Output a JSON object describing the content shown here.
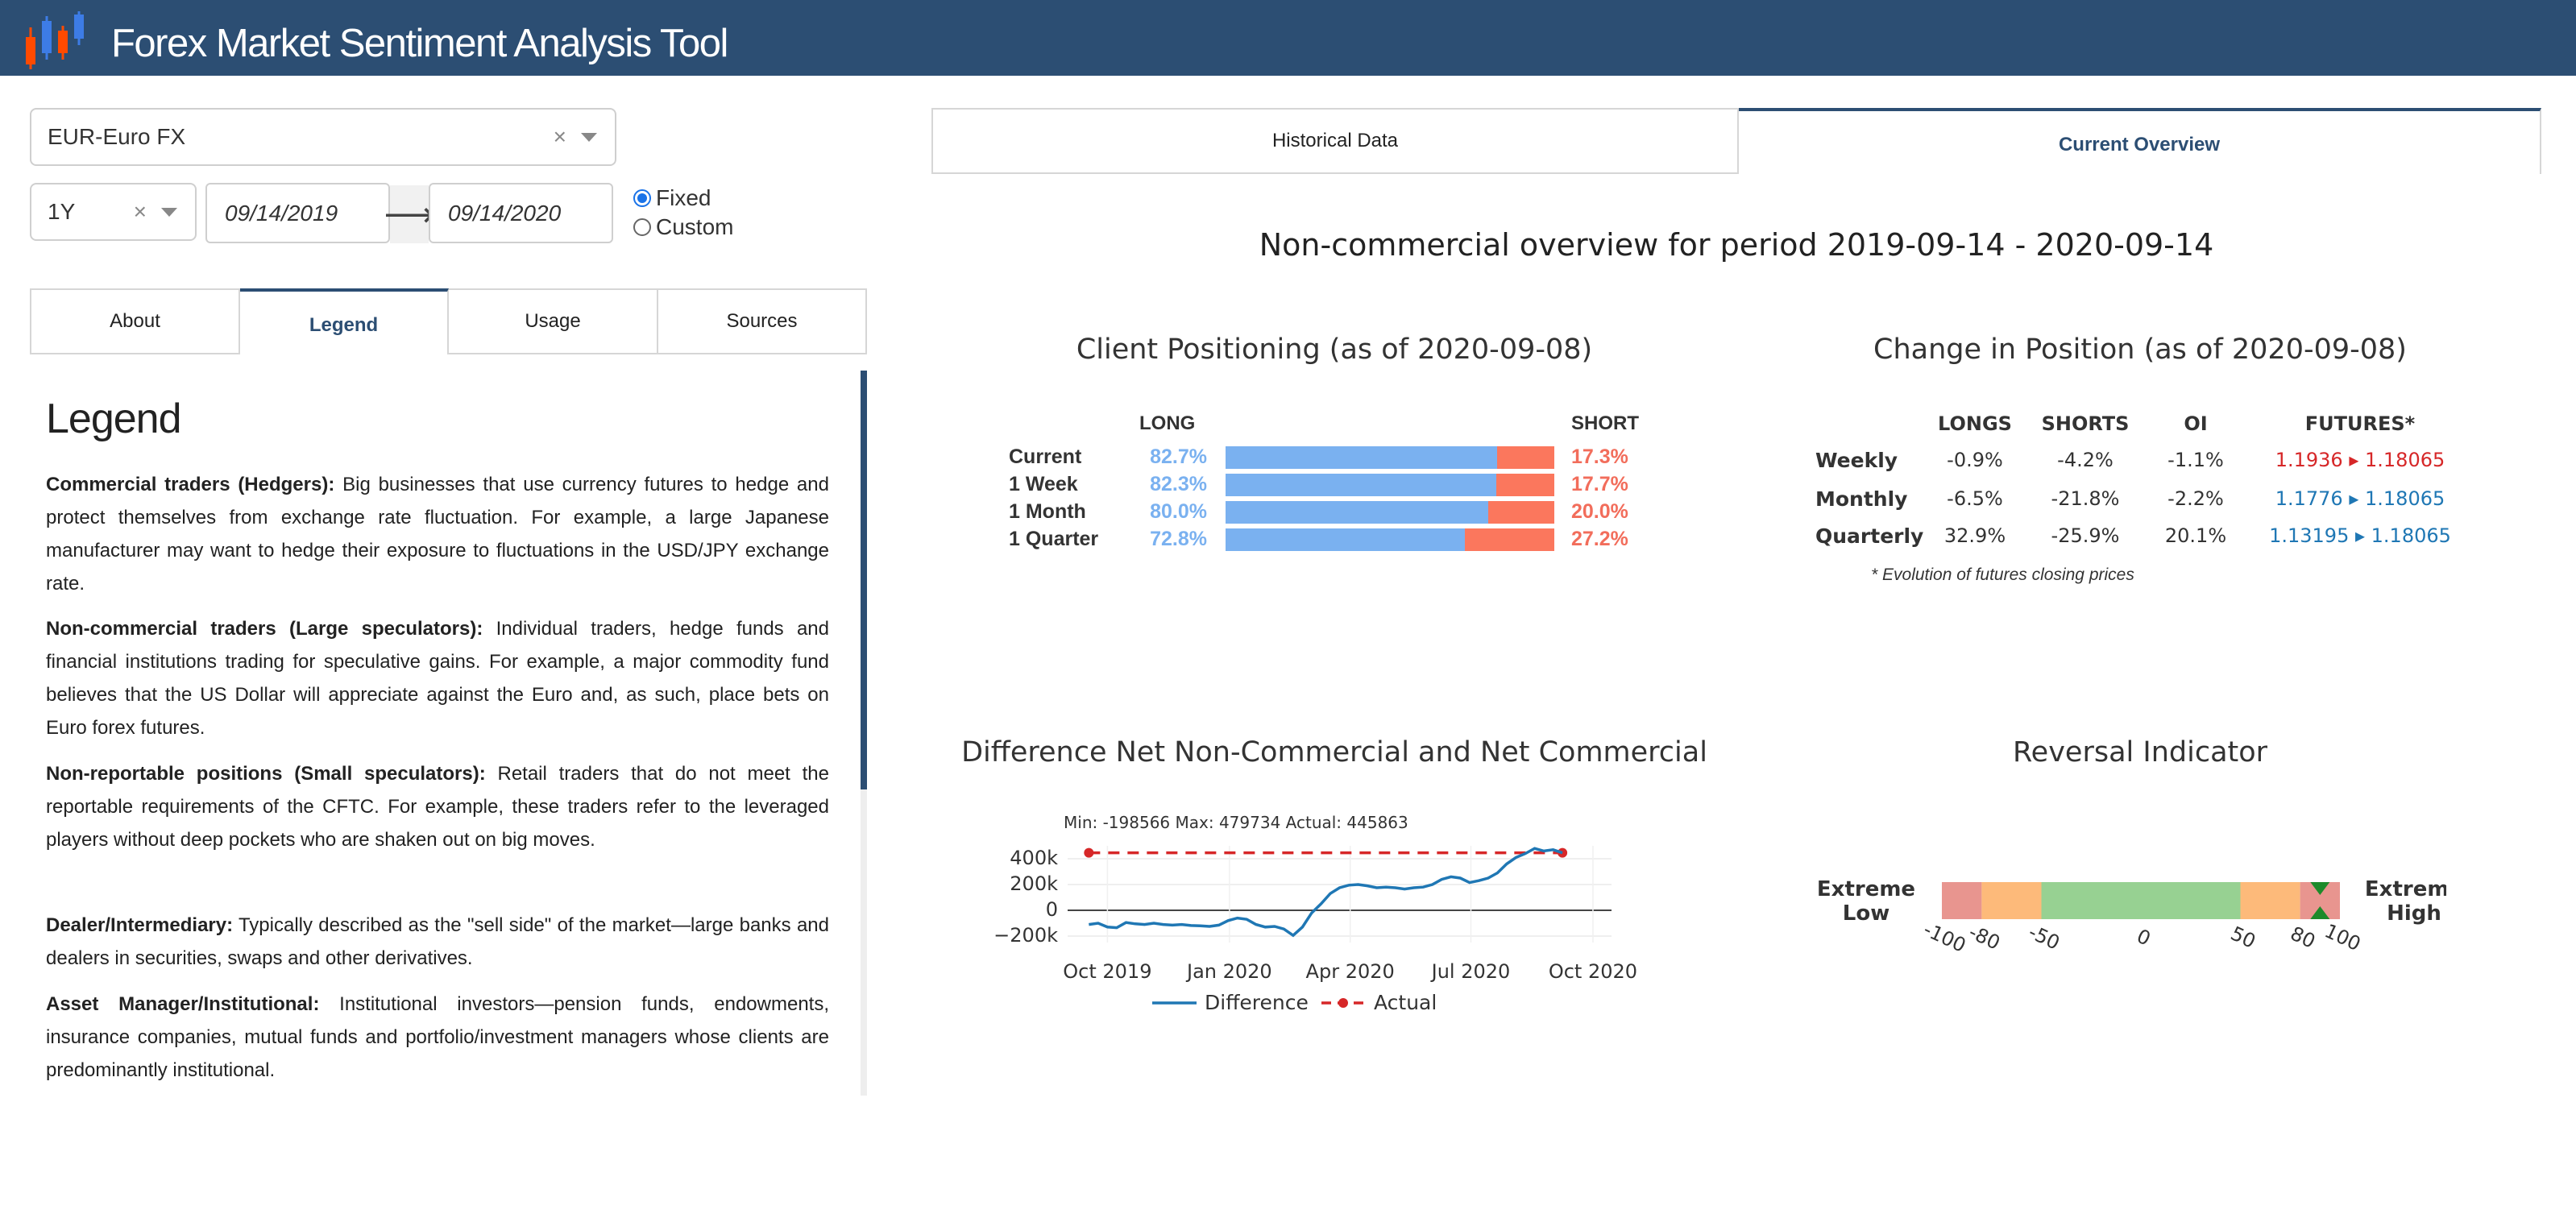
{
  "app": {
    "title": "Forex Market Sentiment Analysis Tool"
  },
  "colors": {
    "header_bg": "#2c4e73",
    "long": "#7ab1f0",
    "short": "#fb775d",
    "up": "#1f77b4",
    "down": "#d62728"
  },
  "controls": {
    "currency": {
      "value": "EUR-Euro FX",
      "clear": "×"
    },
    "period": {
      "value": "1Y",
      "clear": "×"
    },
    "start_date": "09/14/2019",
    "end_date": "09/14/2020",
    "arrow": "⟶",
    "radio_fixed": "Fixed",
    "radio_custom": "Custom",
    "selected_radio": "Fixed"
  },
  "left_tabs": [
    "About",
    "Legend",
    "Usage",
    "Sources"
  ],
  "left_active_tab": "Legend",
  "right_tabs": [
    "Historical Data",
    "Current Overview"
  ],
  "right_active_tab": "Current Overview",
  "legend": {
    "heading": "Legend",
    "items": [
      {
        "term": "Commercial traders (Hedgers):",
        "text": " Big businesses that use currency futures to hedge and protect themselves from exchange rate fluctuation. For example, a large Japanese manufacturer may want to hedge their exposure to fluctuations in the USD/JPY exchange rate."
      },
      {
        "term": "Non-commercial traders (Large speculators):",
        "text": " Individual traders, hedge funds and financial institutions trading for speculative gains. For example, a major commodity fund believes that the US Dollar will appreciate against the Euro and, as such, place bets on Euro forex futures."
      },
      {
        "term": "Non-reportable positions (Small speculators):",
        "text": " Retail traders that do not meet the reportable requirements of the CFTC. For example, these traders refer to the leveraged players without deep pockets who are shaken out on big moves."
      },
      {
        "term": "Dealer/Intermediary:",
        "text": " Typically described as the \"sell side\" of the market—large banks and dealers in securities, swaps and other derivatives."
      },
      {
        "term": "Asset Manager/Institutional:",
        "text": " Institutional investors—pension funds, endowments, insurance companies, mutual funds and portfolio/investment managers whose clients are predominantly institutional."
      }
    ]
  },
  "overview": {
    "title": "Non-commercial overview for period 2019-09-14 - 2020-09-14",
    "positioning": {
      "title": "Client Positioning (as of 2020-09-08)",
      "long_header": "LONG",
      "short_header": "SHORT",
      "rows": [
        {
          "label": "Current",
          "long": "82.7%",
          "short": "17.3%",
          "long_frac": 0.827
        },
        {
          "label": "1 Week",
          "long": "82.3%",
          "short": "17.7%",
          "long_frac": 0.823
        },
        {
          "label": "1 Month",
          "long": "80.0%",
          "short": "20.0%",
          "long_frac": 0.8
        },
        {
          "label": "1 Quarter",
          "long": "72.8%",
          "short": "27.2%",
          "long_frac": 0.728
        }
      ]
    },
    "change": {
      "title": "Change in Position (as of 2020-09-08)",
      "headers": [
        "LONGS",
        "SHORTS",
        "OI",
        "FUTURES*"
      ],
      "rows": [
        {
          "label": "Weekly",
          "longs": "-0.9%",
          "shorts": "-4.2%",
          "oi": "-1.1%",
          "from": "1.1936",
          "to": "1.18065",
          "direction": "down"
        },
        {
          "label": "Monthly",
          "longs": "-6.5%",
          "shorts": "-21.8%",
          "oi": "-2.2%",
          "from": "1.1776",
          "to": "1.18065",
          "direction": "up"
        },
        {
          "label": "Quarterly",
          "longs": "32.9%",
          "shorts": "-25.9%",
          "oi": "20.1%",
          "from": "1.13195",
          "to": "1.18065",
          "direction": "up"
        }
      ],
      "footnote": "* Evolution of futures closing prices"
    },
    "reversal": {
      "title": "Reversal Indicator",
      "low_label_1": "Extreme",
      "low_label_2": "Low",
      "high_label_1": "Extreme",
      "high_label_2": "High",
      "ticks": [
        "-100",
        "-80",
        "-50",
        "0",
        "50",
        "80",
        "100"
      ],
      "value": 90
    }
  },
  "chart_data": {
    "type": "line",
    "title": "Difference Net Non-Commercial and Net Commercial",
    "annotation": "Min: -198566   Max: 479734   Actual: 445863",
    "x_ticks": [
      "Oct 2019",
      "Jan 2020",
      "Apr 2020",
      "Jul 2020",
      "Oct 2020"
    ],
    "y_ticks": [
      "400k",
      "200k",
      "0",
      "−200k"
    ],
    "ylim": [
      -250000,
      500000
    ],
    "x": [
      "2019-09-17",
      "2019-09-24",
      "2019-10-01",
      "2019-10-08",
      "2019-10-15",
      "2019-10-22",
      "2019-10-29",
      "2019-11-05",
      "2019-11-12",
      "2019-11-19",
      "2019-11-26",
      "2019-12-03",
      "2019-12-10",
      "2019-12-17",
      "2019-12-24",
      "2019-12-31",
      "2020-01-07",
      "2020-01-14",
      "2020-01-21",
      "2020-01-28",
      "2020-02-04",
      "2020-02-11",
      "2020-02-18",
      "2020-02-25",
      "2020-03-03",
      "2020-03-10",
      "2020-03-17",
      "2020-03-24",
      "2020-03-31",
      "2020-04-07",
      "2020-04-14",
      "2020-04-21",
      "2020-04-28",
      "2020-05-05",
      "2020-05-12",
      "2020-05-19",
      "2020-05-26",
      "2020-06-02",
      "2020-06-09",
      "2020-06-16",
      "2020-06-23",
      "2020-06-30",
      "2020-07-07",
      "2020-07-14",
      "2020-07-21",
      "2020-07-28",
      "2020-08-04",
      "2020-08-11",
      "2020-08-18",
      "2020-08-25",
      "2020-09-01",
      "2020-09-08"
    ],
    "series": [
      {
        "name": "Difference",
        "color": "#1f77b4",
        "values": [
          -110000,
          -100000,
          -130000,
          -135000,
          -95000,
          -105000,
          -110000,
          -100000,
          -110000,
          -115000,
          -110000,
          -118000,
          -120000,
          -125000,
          -115000,
          -80000,
          -60000,
          -70000,
          -110000,
          -130000,
          -125000,
          -145000,
          -195000,
          -130000,
          -20000,
          50000,
          130000,
          175000,
          195000,
          200000,
          190000,
          175000,
          180000,
          175000,
          165000,
          175000,
          180000,
          200000,
          240000,
          260000,
          250000,
          215000,
          230000,
          250000,
          290000,
          360000,
          410000,
          440000,
          480000,
          460000,
          470000,
          445863
        ]
      },
      {
        "name": "Actual",
        "color": "#d62728",
        "dashed": true,
        "values": [
          445863,
          445863
        ]
      }
    ],
    "legend": [
      "Difference",
      "Actual"
    ]
  }
}
